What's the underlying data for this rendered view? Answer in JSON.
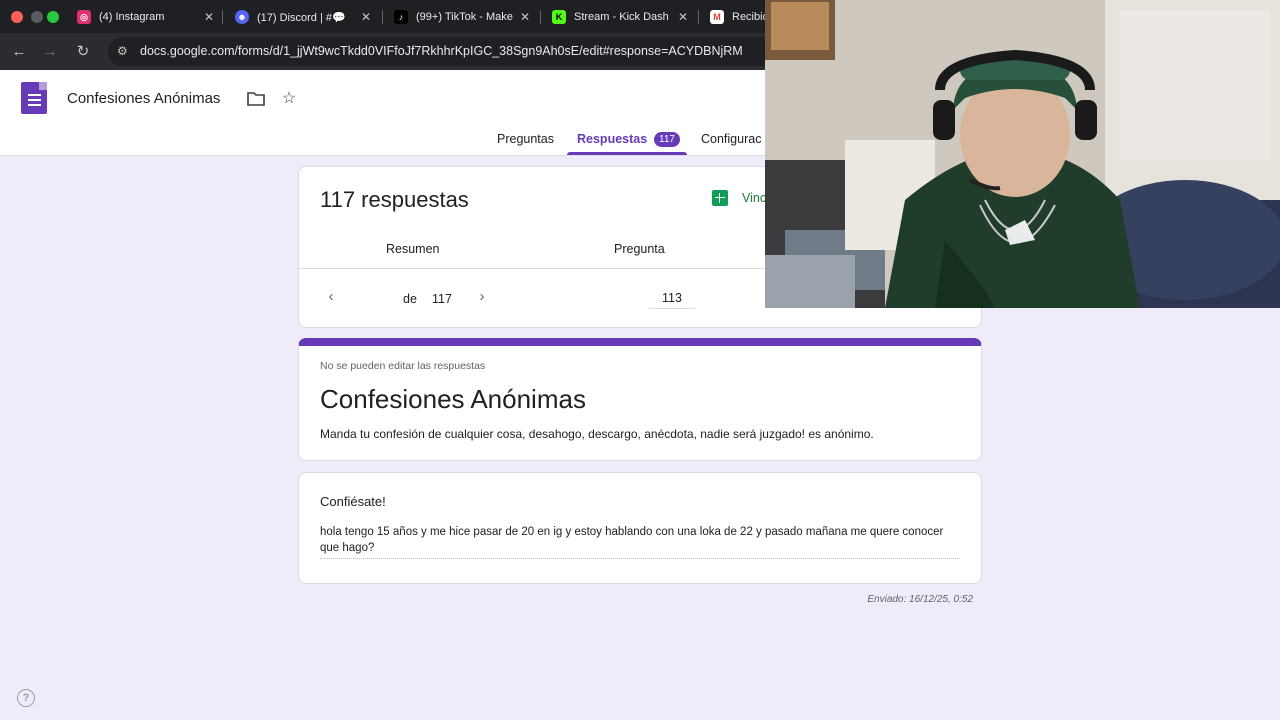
{
  "browser": {
    "tabs": [
      {
        "title": "(4) Instagram",
        "icon": "instagram-icon",
        "color": "#e1306c"
      },
      {
        "title": "(17) Discord | #💬",
        "icon": "discord-icon",
        "color": "#5865f2"
      },
      {
        "title": "(99+) TikTok - Make",
        "icon": "tiktok-icon",
        "color": "#000000"
      },
      {
        "title": "Stream - Kick Dash",
        "icon": "kick-icon",
        "color": "#53fc18"
      },
      {
        "title": "Recibid",
        "icon": "gmail-icon",
        "color": "#ea4335"
      }
    ],
    "url": "docs.google.com/forms/d/1_jjWt9wcTkdd0VIFfoJf7RkhhrKpIGC_38Sgn9Ah0sE/edit#response=ACYDBNjRM"
  },
  "header": {
    "doc_title": "Confesiones Anónimas",
    "tabs": [
      "Preguntas",
      "Respuestas",
      "Configurac"
    ],
    "response_count_badge": "117",
    "accent": "#673ab7"
  },
  "responses": {
    "title": "117 respuestas",
    "sheets_link": "Vinc",
    "subtabs": [
      "Resumen",
      "Pregunta"
    ],
    "pager": {
      "current": "113",
      "of_label": "de",
      "total": "117"
    }
  },
  "form": {
    "note": "No se pueden editar las respuestas",
    "title": "Confesiones Anónimas",
    "description": "Manda tu confesión de cualquier cosa, desahogo, descargo, anécdota, nadie será juzgado! es anónimo."
  },
  "question": {
    "title": "Confiésate!",
    "answer": "hola tengo 15 años y me hice pasar de 20 en ig y estoy hablando con una loka de 22 y pasado mañana me quere conocer que hago?"
  },
  "submitted": "Enviado: 16/12/25, 0:52"
}
